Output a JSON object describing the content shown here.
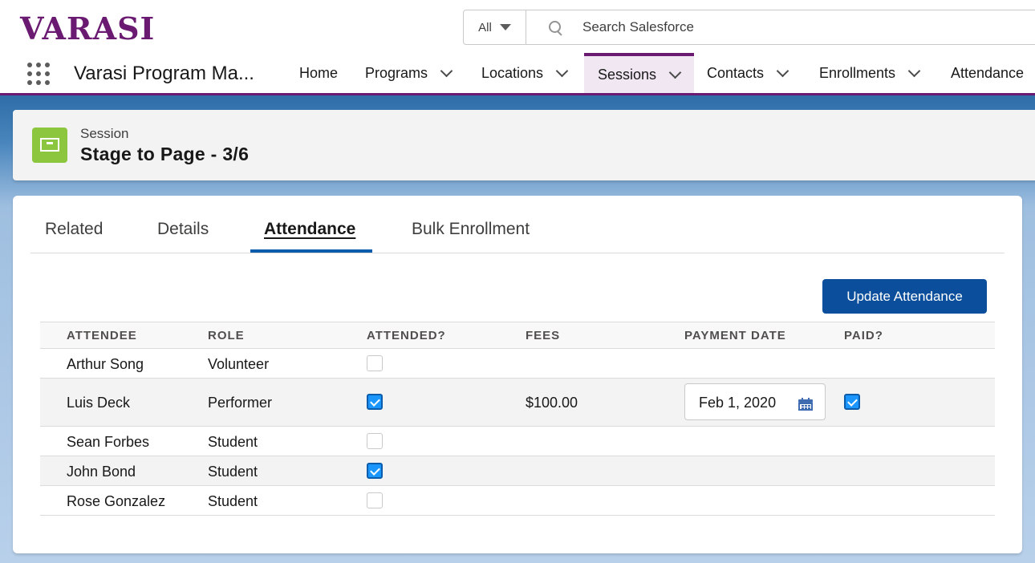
{
  "brand": {
    "logo_text": "VARASI"
  },
  "search": {
    "scope": "All",
    "placeholder": "Search Salesforce"
  },
  "nav": {
    "app_name": "Varasi Program Ma...",
    "items": [
      {
        "label": "Home"
      },
      {
        "label": "Programs"
      },
      {
        "label": "Locations"
      },
      {
        "label": "Sessions"
      },
      {
        "label": "Contacts"
      },
      {
        "label": "Enrollments"
      },
      {
        "label": "Attendance"
      }
    ]
  },
  "record": {
    "type": "Session",
    "title": "Stage to Page - 3/6"
  },
  "tabs": [
    {
      "label": "Related"
    },
    {
      "label": "Details"
    },
    {
      "label": "Attendance"
    },
    {
      "label": "Bulk Enrollment"
    }
  ],
  "actions": {
    "update_label": "Update Attendance"
  },
  "table": {
    "headers": [
      "ATTENDEE",
      "ROLE",
      "ATTENDED?",
      "FEES",
      "PAYMENT DATE",
      "PAID?"
    ],
    "rows": [
      {
        "attendee": "Arthur Song",
        "role": "Volunteer",
        "attended": false,
        "fees": "",
        "payment_date": "",
        "paid": null
      },
      {
        "attendee": "Luis Deck",
        "role": "Performer",
        "attended": true,
        "fees": "$100.00",
        "payment_date": "Feb 1, 2020",
        "paid": true
      },
      {
        "attendee": "Sean Forbes",
        "role": "Student",
        "attended": false,
        "fees": "",
        "payment_date": "",
        "paid": null
      },
      {
        "attendee": "John Bond",
        "role": "Student",
        "attended": true,
        "fees": "",
        "payment_date": "",
        "paid": null
      },
      {
        "attendee": "Rose Gonzalez",
        "role": "Student",
        "attended": false,
        "fees": "",
        "payment_date": "",
        "paid": null
      }
    ]
  },
  "colors": {
    "brand": "#6b1a72",
    "primary_button": "#0b4f9c",
    "record_icon": "#8cc63f",
    "checkbox_checked": "#1b96ff"
  },
  "icons": {
    "record": "session-desk-icon",
    "search": "search-icon",
    "app_launcher": "app-launcher-icon",
    "date": "calendar-icon"
  }
}
